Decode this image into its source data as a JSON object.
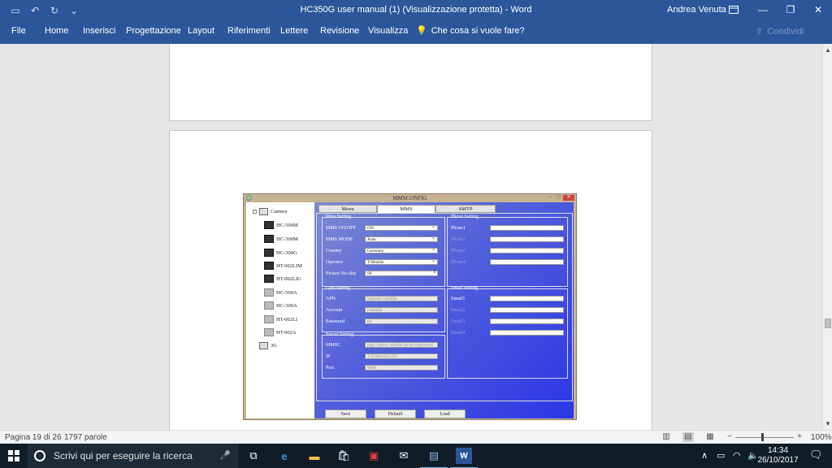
{
  "window": {
    "title": "HC350G user manual (1) (Visualizzazione protetta)  -  Word",
    "user": "Andrea Venuta",
    "share_label": "Condividi"
  },
  "ribbon": {
    "tabs": [
      "File",
      "Home",
      "Inserisci",
      "Progettazione",
      "Layout",
      "Riferimenti",
      "Lettere",
      "Revisione",
      "Visualizza"
    ],
    "tell_me": "Che cosa si vuole fare?"
  },
  "screenshot": {
    "title": "MMSCONFIG",
    "tree": {
      "root": "Camera",
      "items": [
        "HC-500M",
        "HC-300M",
        "HC-300G",
        "HT-002LIM",
        "HT-002LIG",
        "HC-500A",
        "HC-300A",
        "HT-002LI",
        "HT-002A"
      ],
      "other": "3G"
    },
    "tabs": [
      "Menu",
      "MMS",
      "SMTP"
    ],
    "mms_setting": {
      "label": "Mms Setting",
      "rows": [
        {
          "label": "MMS ON/OFF",
          "value": "ON"
        },
        {
          "label": "MMS MODE",
          "value": "Auto"
        },
        {
          "label": "Country",
          "value": "Germany"
        },
        {
          "label": "Operator",
          "value": "T-Mobile"
        },
        {
          "label": "Picture No./day",
          "value": "99"
        }
      ]
    },
    "gprs_setting": {
      "label": "Gprs Setting",
      "rows": [
        {
          "label": "APN",
          "value": "internet.t-mobile"
        },
        {
          "label": "Account",
          "value": "t-mobile"
        },
        {
          "label": "Password",
          "value": "tm"
        }
      ]
    },
    "server_setting": {
      "label": "Server Setting",
      "rows": [
        {
          "label": "MMSC",
          "value": "http://mms.t-mobile.de/servlets/mms"
        },
        {
          "label": "IP",
          "value": "172.028.023.131"
        },
        {
          "label": "Port",
          "value": "8008"
        }
      ]
    },
    "phone_setting": {
      "label": "Phone Setting",
      "rows": [
        "Phone1",
        "Phone2",
        "Phone3",
        "Phone4"
      ]
    },
    "email_setting": {
      "label": "Email Setting",
      "rows": [
        "Email1",
        "Email2",
        "Email3",
        "Email4"
      ]
    },
    "buttons": [
      "Save",
      "Default",
      "Load"
    ]
  },
  "statusbar": {
    "page": "Pagina 19 di 26",
    "words": "1797 parole",
    "zoom": "100%"
  },
  "taskbar": {
    "search_placeholder": "Scrivi qui per eseguire la ricerca",
    "time": "14:34",
    "date": "26/10/2017"
  }
}
